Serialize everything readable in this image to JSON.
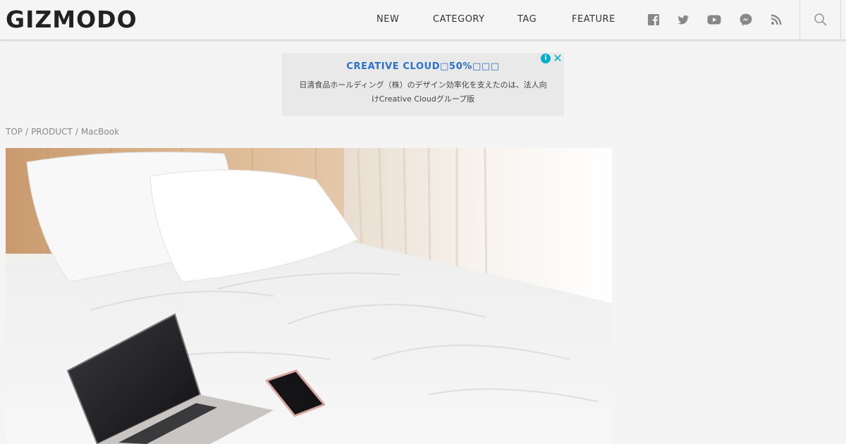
{
  "header": {
    "logo": "GIZMODO",
    "nav": [
      {
        "label": "NEW"
      },
      {
        "label": "CATEGORY"
      },
      {
        "label": "TAG"
      },
      {
        "label": "FEATURE"
      }
    ],
    "social_icons": [
      "facebook-icon",
      "twitter-icon",
      "youtube-icon",
      "messenger-icon",
      "rss-icon"
    ],
    "search_icon": "search-icon"
  },
  "ad": {
    "title": "CREATIVE CLOUD□50%□□□",
    "body_line1": "日清食品ホールディング（株）のデザイン効率化を支えたのは、法人向",
    "body_line2": "けCreative Cloudグループ版",
    "info_symbol": "i",
    "close_symbol": "✕",
    "accent_color": "#2a6fc9"
  },
  "breadcrumb": [
    {
      "label": "TOP"
    },
    {
      "label": "PRODUCT"
    },
    {
      "label": "MacBook"
    }
  ],
  "breadcrumb_separator": "/",
  "colors": {
    "background": "#f4f4f4",
    "header_bg": "#f5f5f5",
    "ad_bg": "#e9e9e9",
    "icon_gray": "#888888"
  }
}
